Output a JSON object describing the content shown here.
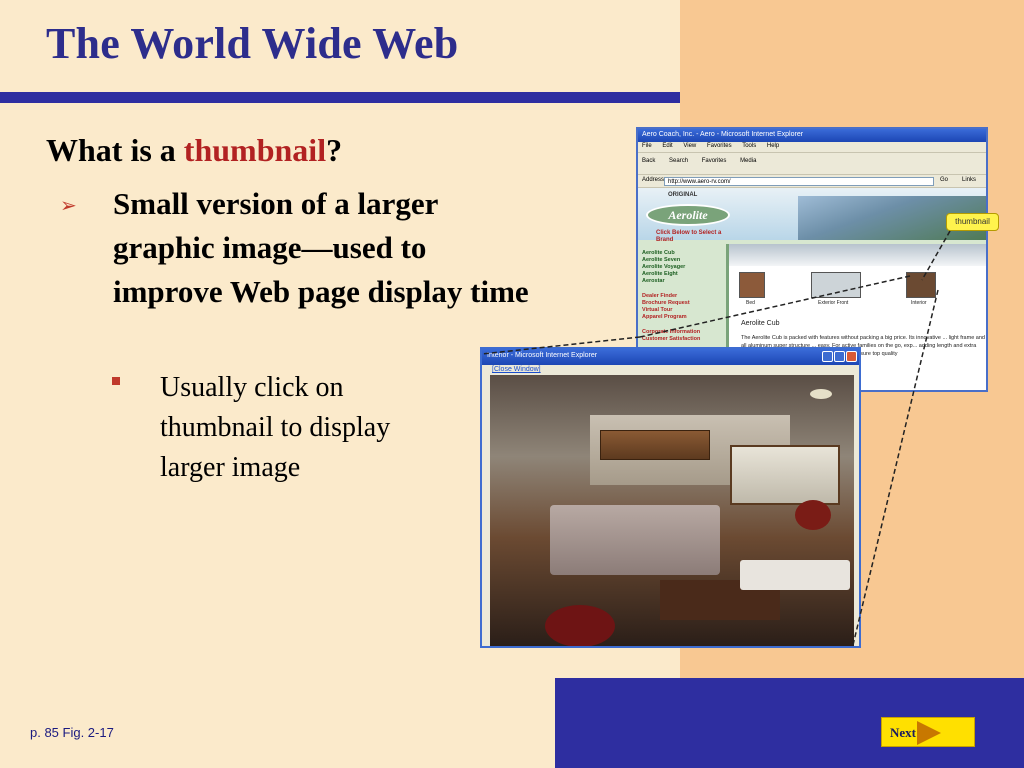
{
  "slide": {
    "title": "The World Wide Web",
    "question_prefix": "What is a ",
    "question_highlight": "thumbnail",
    "question_suffix": "?",
    "bullet1_marker": "➢",
    "bullet1": "Small version of a larger graphic image—used to improve Web page display time",
    "bullet2": "Usually click on thumbnail to display larger image",
    "page_ref": "p. 85 Fig. 2-17",
    "next_label": "Next"
  },
  "back_window": {
    "title": "Aero Coach, Inc. - Aero - Microsoft Internet Explorer",
    "menu": [
      "File",
      "Edit",
      "View",
      "Favorites",
      "Tools",
      "Help"
    ],
    "toolbar": [
      "Back",
      "Search",
      "Favorites",
      "Media"
    ],
    "address_label": "Address",
    "address_value": "http://www.aero-rv.com/",
    "go_label": "Go",
    "links_label": "Links",
    "site": {
      "logo_top": "ORIGINAL",
      "logo": "Aerolite",
      "click_below": "Click Below to Select a Brand",
      "brands": [
        "Aerolite Cub",
        "Aerolite Seven",
        "Aerolite Voyager",
        "Aerolite Eight",
        "Aerostar"
      ],
      "links": [
        "Dealer Finder",
        "Brochure Request",
        "Virtual Tour",
        "Apparel Program",
        "Corporate Information",
        "Customer Satisfaction"
      ],
      "thumb_captions": [
        "Bed",
        "Exterior Front",
        "Interior"
      ],
      "cub_title": "Aerolite Cub",
      "cub_text": "The Aerolite Cub is packed with features without packing a big price. Its innovative ... light frame and all aluminum super structure ... easy. For active families on the go, exp... adding length and extra weight to the unit ... carry a 5 year warranty to ensure top quality"
    }
  },
  "callout": "thumbnail",
  "front_window": {
    "title": "Interior - Microsoft Internet Explorer",
    "close_link": "[Close Window]"
  },
  "colors": {
    "background": "#fbeacb",
    "accent_band": "#f8c892",
    "navy": "#2e2ea0",
    "title": "#2d2d8c",
    "highlight": "#b22222",
    "next_button": "#ffe000"
  }
}
